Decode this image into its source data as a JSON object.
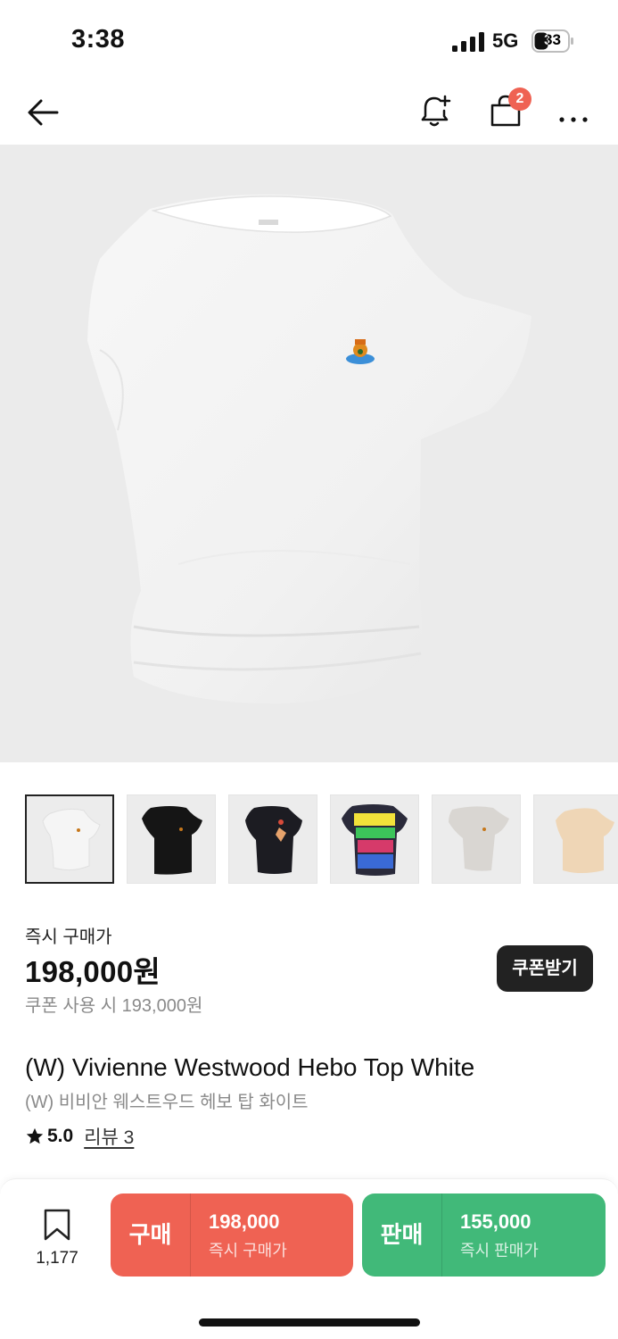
{
  "status_bar": {
    "time": "3:38",
    "network": "5G",
    "battery": "33"
  },
  "header": {
    "back_icon": "arrow-left-icon",
    "bell_icon": "bell-plus-icon",
    "cart_icon": "shopping-bag-icon",
    "cart_count": "2",
    "more_icon": "more-horizontal-icon"
  },
  "product": {
    "hero_image": "white-asymmetric-top-with-orb-logo",
    "thumbnails": [
      {
        "name": "white-top"
      },
      {
        "name": "black-top"
      },
      {
        "name": "black-top-print"
      },
      {
        "name": "multicolor-graphic-top"
      },
      {
        "name": "grey-top"
      },
      {
        "name": "beige-top"
      }
    ],
    "price_label": "즉시 구매가",
    "price": "198,000원",
    "coupon_price": "쿠폰 사용 시 193,000원",
    "coupon_button": "쿠폰받기",
    "title_en": "(W) Vivienne Westwood Hebo Top White",
    "title_ko": "(W) 비비안 웨스트우드 헤보 탑 화이트",
    "rating": "5.0",
    "review_label": "리뷰 3"
  },
  "bottom_bar": {
    "wish_count": "1,177",
    "buy": {
      "label": "구매",
      "price": "198,000",
      "sub": "즉시 구매가"
    },
    "sell": {
      "label": "판매",
      "price": "155,000",
      "sub": "즉시 판매가"
    }
  },
  "colors": {
    "buy": "#ef6253",
    "sell": "#41b979",
    "coupon_button": "#222222",
    "badge": "#ef6253"
  }
}
